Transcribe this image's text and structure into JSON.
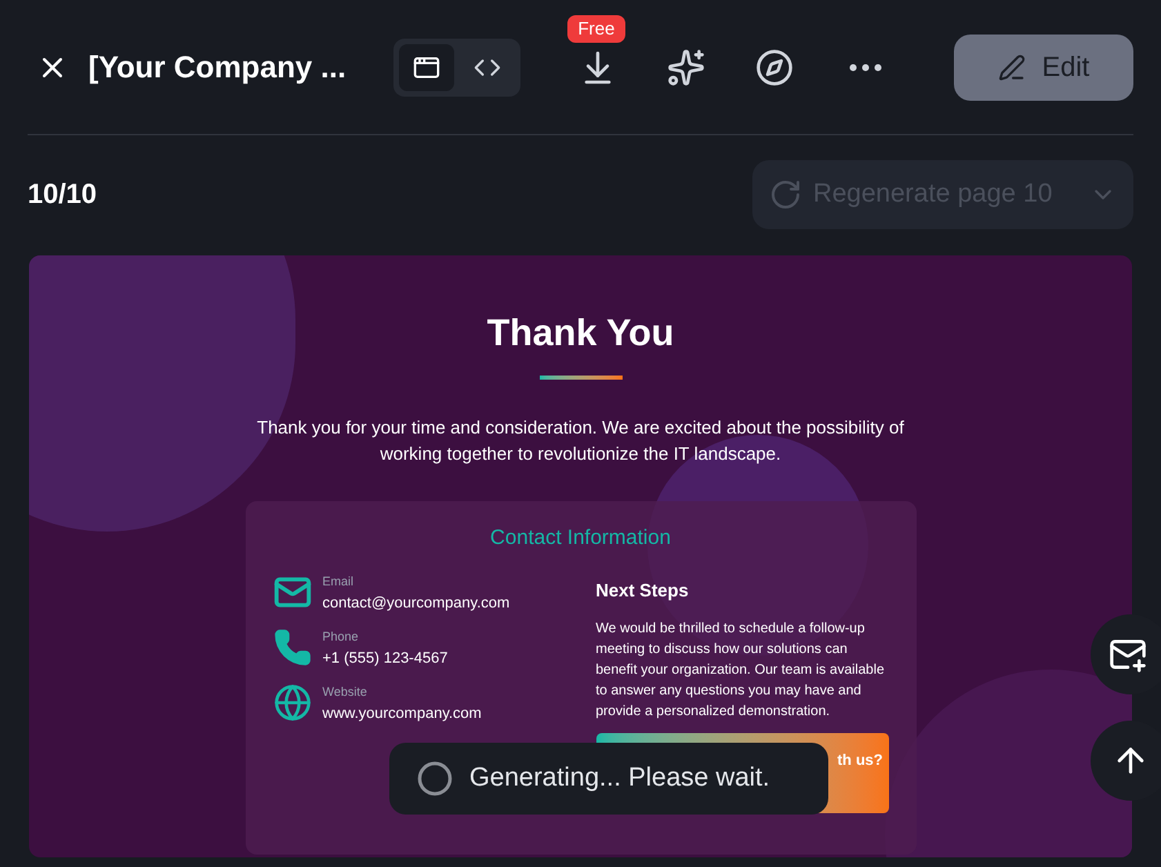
{
  "header": {
    "title": "[Your Company ...",
    "view_toggle": [
      {
        "kind": "preview",
        "selected": true
      },
      {
        "kind": "code",
        "selected": false
      }
    ],
    "download_badge": "Free",
    "edit_button": "Edit"
  },
  "page_bar": {
    "counter": "10/10",
    "regenerate_button": "Regenerate page 10"
  },
  "slide": {
    "title": "Thank You",
    "intro": "Thank you for your time and consideration. We are excited about the possibility of working together to revolutionize the IT landscape.",
    "contact": {
      "heading": "Contact Information",
      "items": [
        {
          "kind": "email",
          "label": "Email",
          "value": "contact@yourcompany.com"
        },
        {
          "kind": "phone",
          "label": "Phone",
          "value": "+1 (555) 123-4567"
        },
        {
          "kind": "website",
          "label": "Website",
          "value": "www.yourcompany.com"
        }
      ],
      "next_steps": {
        "heading": "Next Steps",
        "text": "We would be thrilled to schedule a follow-up meeting to discuss how our solutions can benefit your organization. Our team is available to answer any questions you may have and provide a personalized demonstration.",
        "cta": "th us?"
      }
    }
  },
  "toast": {
    "text": "Generating... Please wait."
  }
}
